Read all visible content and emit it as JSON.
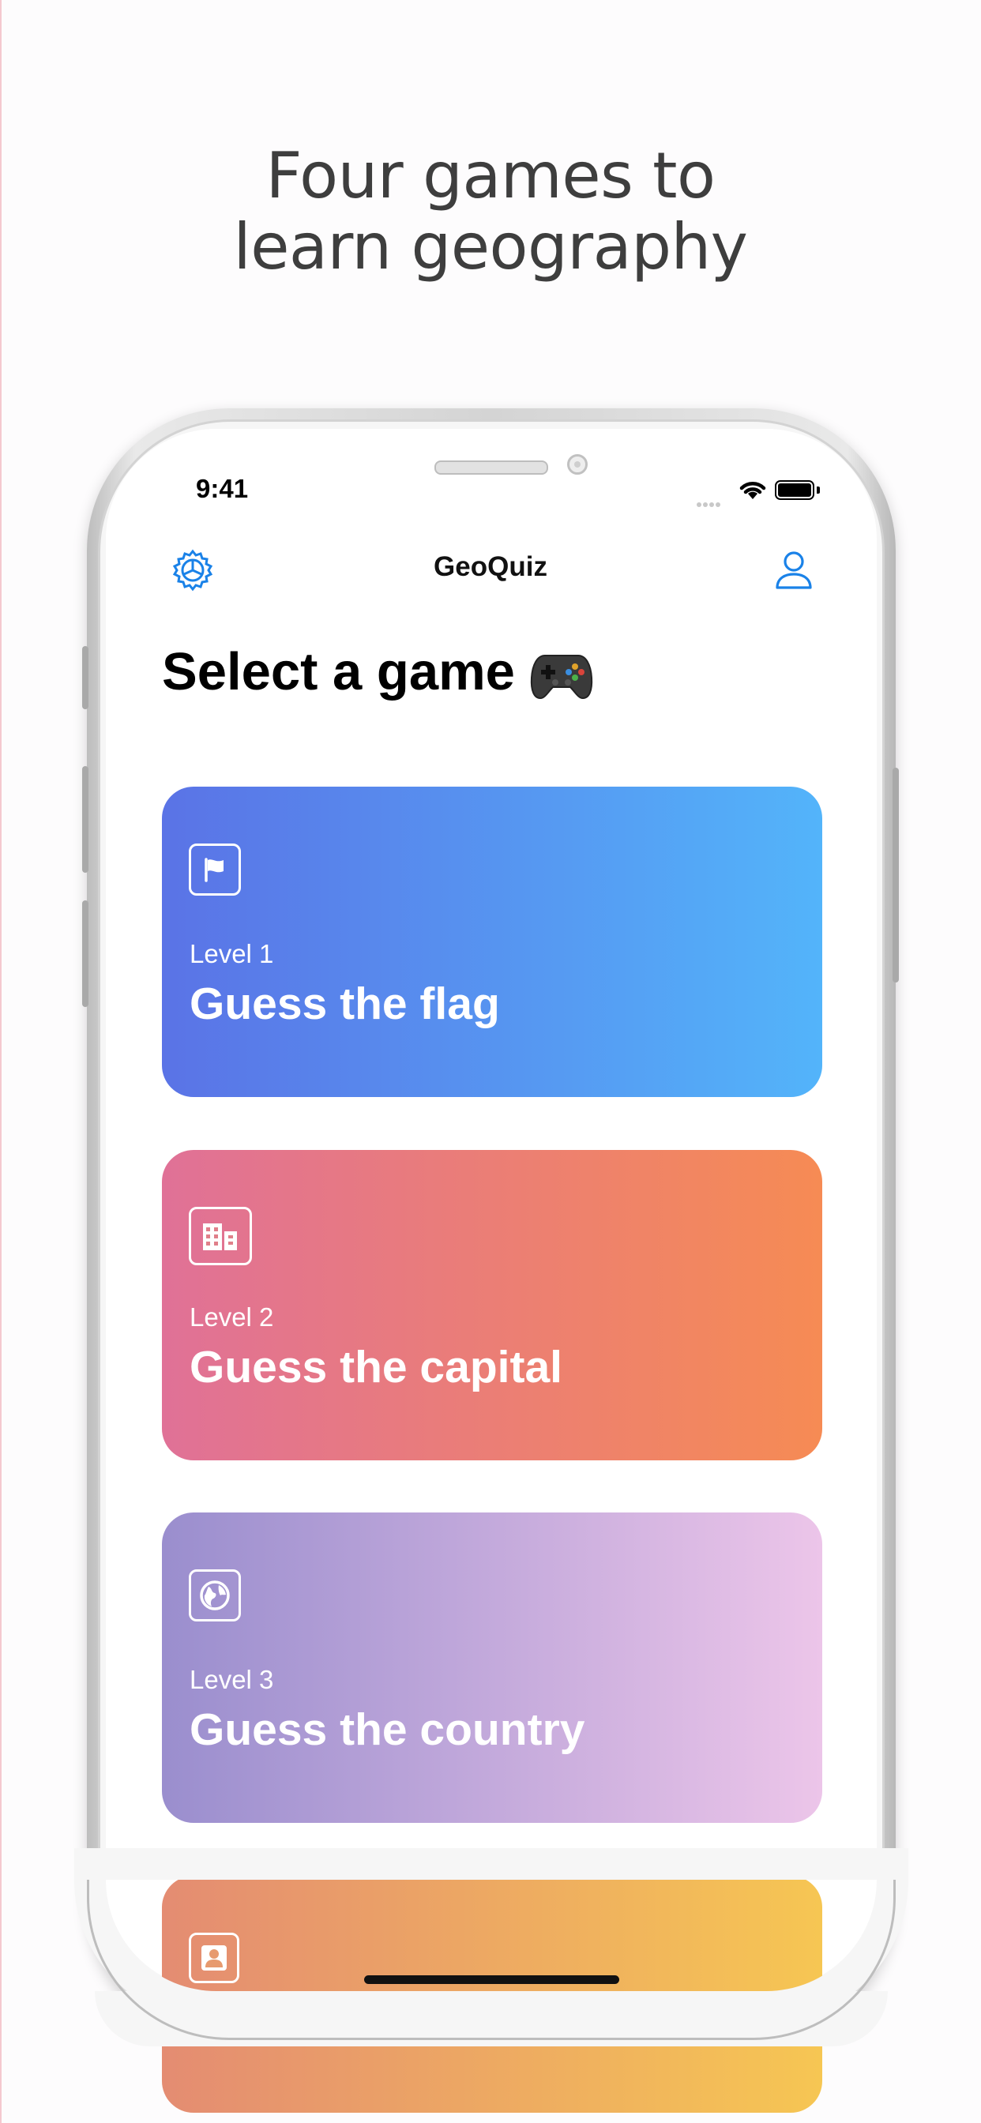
{
  "headline": {
    "line1": "Four games to",
    "line2": "learn geography"
  },
  "status_bar": {
    "time": "9:41",
    "icons": [
      "signal-icon",
      "wifi-icon",
      "battery-icon"
    ]
  },
  "nav": {
    "title": "GeoQuiz",
    "left_icon": "settings-icon",
    "right_icon": "profile-icon",
    "accent_color": "#1a82e8"
  },
  "page": {
    "title": "Select a game",
    "title_icon": "gamepad-icon"
  },
  "games": [
    {
      "level": "Level 1",
      "title": "Guess the flag",
      "icon": "flag-icon",
      "colors": [
        "#5a73e6",
        "#53b4fa"
      ]
    },
    {
      "level": "Level 2",
      "title": "Guess the capital",
      "icon": "buildings-icon",
      "colors": [
        "#e07197",
        "#f68b54"
      ]
    },
    {
      "level": "Level 3",
      "title": "Guess the country",
      "icon": "globe-icon",
      "colors": [
        "#9a8ece",
        "#ecc5e9"
      ]
    },
    {
      "level": "",
      "title": "",
      "icon": "person-icon",
      "colors": [
        "#e48c72",
        "#f6c653"
      ]
    }
  ]
}
